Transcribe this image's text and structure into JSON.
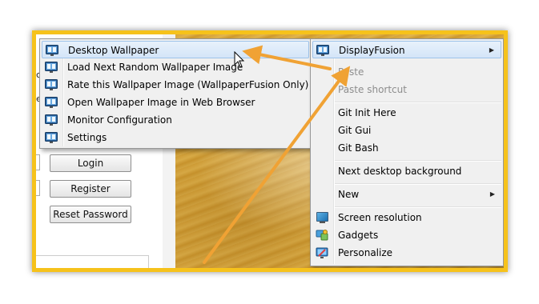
{
  "left_page": {
    "cut_letters": [
      "c",
      "et"
    ],
    "buttons": {
      "login": "Login",
      "register": "Register",
      "reset_password": "Reset Password"
    }
  },
  "submenu": {
    "items": [
      {
        "label": "Desktop Wallpaper",
        "icon": "displayfusion-icon",
        "highlighted": true
      },
      {
        "label": "Load Next Random Wallpaper Image",
        "icon": "displayfusion-icon"
      },
      {
        "label": "Rate this Wallpaper Image (WallpaperFusion Only)",
        "icon": "displayfusion-icon"
      },
      {
        "label": "Open Wallpaper Image in Web Browser",
        "icon": "displayfusion-icon"
      },
      {
        "label": "Monitor Configuration",
        "icon": "displayfusion-icon"
      },
      {
        "label": "Settings",
        "icon": "displayfusion-icon"
      }
    ]
  },
  "context_menu": {
    "displayfusion": "DisplayFusion",
    "paste": "Paste",
    "paste_shortcut": "Paste shortcut",
    "git_init": "Git Init Here",
    "git_gui": "Git Gui",
    "git_bash": "Git Bash",
    "next_background": "Next desktop background",
    "new": "New",
    "screen_resolution": "Screen resolution",
    "gadgets": "Gadgets",
    "personalize": "Personalize",
    "submenu_arrow": "▶"
  },
  "colors": {
    "frame_border": "#f6c21b",
    "annotation_arrow": "#f0a234",
    "highlight": "#d4e5f8"
  }
}
